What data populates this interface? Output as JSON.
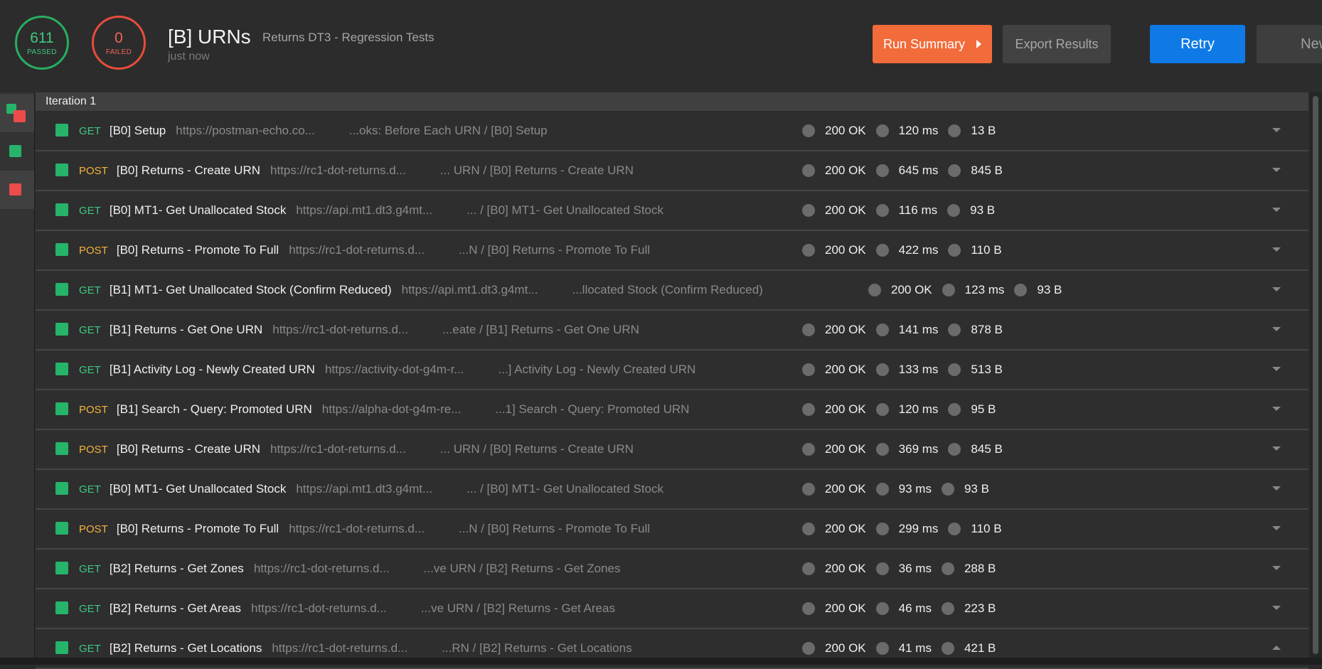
{
  "summary": {
    "passed_count": "611",
    "passed_label": "PASSED",
    "failed_count": "0",
    "failed_label": "FAILED",
    "title": "[B] URNs",
    "subtitle": "Returns DT3 - Regression Tests",
    "time_ago": "just now"
  },
  "toolbar": {
    "run_summary": "Run Summary",
    "export_results": "Export Results",
    "retry": "Retry",
    "new": "New"
  },
  "colors": {
    "passed": "#27ae60",
    "failed": "#e74c3c",
    "run_summary_bg": "#f26b3a",
    "retry_bg": "#0f7ae5",
    "get_method": "#3fc782",
    "post_method": "#f3b33d"
  },
  "iteration_label": "Iteration 1",
  "requests": [
    {
      "method": "GET",
      "name": "[B0] Setup",
      "url": "https://postman-echo.co...",
      "path": "...oks: Before Each URN / [B0] Setup",
      "status": "200 OK",
      "time": "120 ms",
      "size": "13 B",
      "expanded": false
    },
    {
      "method": "POST",
      "name": "[B0] Returns - Create URN",
      "url": "https://rc1-dot-returns.d...",
      "path": "... URN / [B0] Returns - Create URN",
      "status": "200 OK",
      "time": "645 ms",
      "size": "845 B",
      "expanded": false
    },
    {
      "method": "GET",
      "name": "[B0] MT1- Get Unallocated Stock",
      "url": "https://api.mt1.dt3.g4mt...",
      "path": "... / [B0] MT1- Get Unallocated Stock",
      "status": "200 OK",
      "time": "116 ms",
      "size": "93 B",
      "expanded": false
    },
    {
      "method": "POST",
      "name": "[B0] Returns - Promote To Full",
      "url": "https://rc1-dot-returns.d...",
      "path": "...N / [B0] Returns - Promote To Full",
      "status": "200 OK",
      "time": "422 ms",
      "size": "110 B",
      "expanded": false
    },
    {
      "method": "GET",
      "name": "[B1] MT1- Get Unallocated Stock (Confirm Reduced)",
      "url": "https://api.mt1.dt3.g4mt...",
      "path": "...llocated Stock (Confirm Reduced)",
      "status": "200 OK",
      "time": "123 ms",
      "size": "93 B",
      "expanded": false
    },
    {
      "method": "GET",
      "name": "[B1] Returns - Get One URN",
      "url": "https://rc1-dot-returns.d...",
      "path": "...eate / [B1] Returns - Get One URN",
      "status": "200 OK",
      "time": "141 ms",
      "size": "878 B",
      "expanded": false
    },
    {
      "method": "GET",
      "name": "[B1] Activity Log - Newly Created URN",
      "url": "https://activity-dot-g4m-r...",
      "path": "...] Activity Log - Newly Created URN",
      "status": "200 OK",
      "time": "133 ms",
      "size": "513 B",
      "expanded": false
    },
    {
      "method": "POST",
      "name": "[B1] Search - Query: Promoted URN",
      "url": "https://alpha-dot-g4m-re...",
      "path": "...1] Search - Query: Promoted URN",
      "status": "200 OK",
      "time": "120 ms",
      "size": "95 B",
      "expanded": false
    },
    {
      "method": "POST",
      "name": "[B0] Returns - Create URN",
      "url": "https://rc1-dot-returns.d...",
      "path": "... URN / [B0] Returns - Create URN",
      "status": "200 OK",
      "time": "369 ms",
      "size": "845 B",
      "expanded": false
    },
    {
      "method": "GET",
      "name": "[B0] MT1- Get Unallocated Stock",
      "url": "https://api.mt1.dt3.g4mt...",
      "path": "... / [B0] MT1- Get Unallocated Stock",
      "status": "200 OK",
      "time": "93 ms",
      "size": "93 B",
      "expanded": false
    },
    {
      "method": "POST",
      "name": "[B0] Returns - Promote To Full",
      "url": "https://rc1-dot-returns.d...",
      "path": "...N / [B0] Returns - Promote To Full",
      "status": "200 OK",
      "time": "299 ms",
      "size": "110 B",
      "expanded": false
    },
    {
      "method": "GET",
      "name": "[B2] Returns - Get Zones",
      "url": "https://rc1-dot-returns.d...",
      "path": "...ve URN / [B2] Returns - Get Zones",
      "status": "200 OK",
      "time": "36 ms",
      "size": "288 B",
      "expanded": false
    },
    {
      "method": "GET",
      "name": "[B2] Returns - Get Areas",
      "url": "https://rc1-dot-returns.d...",
      "path": "...ve URN / [B2] Returns - Get Areas",
      "status": "200 OK",
      "time": "46 ms",
      "size": "223 B",
      "expanded": false
    },
    {
      "method": "GET",
      "name": "[B2] Returns - Get Locations",
      "url": "https://rc1-dot-returns.d...",
      "path": "...RN / [B2] Returns - Get Locations",
      "status": "200 OK",
      "time": "41 ms",
      "size": "421 B",
      "expanded": true
    }
  ]
}
